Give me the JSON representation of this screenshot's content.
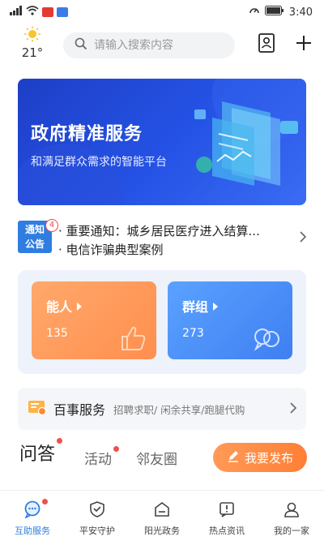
{
  "status_bar": {
    "time": "3:40",
    "colors": {
      "notif1": "#e53935",
      "notif2": "#3d7be8"
    }
  },
  "header": {
    "weather_icon": "sun-icon",
    "temperature": "21°",
    "search_placeholder": "请输入搜索内容"
  },
  "banner": {
    "title": "政府精准服务",
    "subtitle": "和满足群众需求的智能平台"
  },
  "notice": {
    "badge_label_line1": "通知",
    "badge_label_line2": "公告",
    "count": "4",
    "items": [
      "· 重要通知：城乡居民医疗进入结算...",
      "· 电信诈骗典型案例"
    ]
  },
  "cards": [
    {
      "title": "能人",
      "count": "135",
      "icon": "thumbs-up-icon",
      "color": "#ff9a57"
    },
    {
      "title": "群组",
      "count": "273",
      "icon": "chat-bubbles-icon",
      "color": "#4c8ff8"
    }
  ],
  "services": {
    "icon": "service-icon",
    "title": "百事服务",
    "desc": "招聘求职/ 闲余共享/跑腿代购"
  },
  "tabs": {
    "items": [
      "问答",
      "活动",
      "邻友圈"
    ],
    "active_index": 0,
    "publish_label": "我要发布"
  },
  "bottom_nav": {
    "items": [
      {
        "label": "互助服务",
        "icon": "chat-icon",
        "active": true,
        "badge": true
      },
      {
        "label": "平安守护",
        "icon": "shield-icon",
        "active": false,
        "badge": false
      },
      {
        "label": "阳光政务",
        "icon": "government-icon",
        "active": false,
        "badge": false
      },
      {
        "label": "热点资讯",
        "icon": "news-icon",
        "active": false,
        "badge": false
      },
      {
        "label": "我的一家",
        "icon": "person-icon",
        "active": false,
        "badge": false
      }
    ],
    "accent": "#2f7de1"
  }
}
